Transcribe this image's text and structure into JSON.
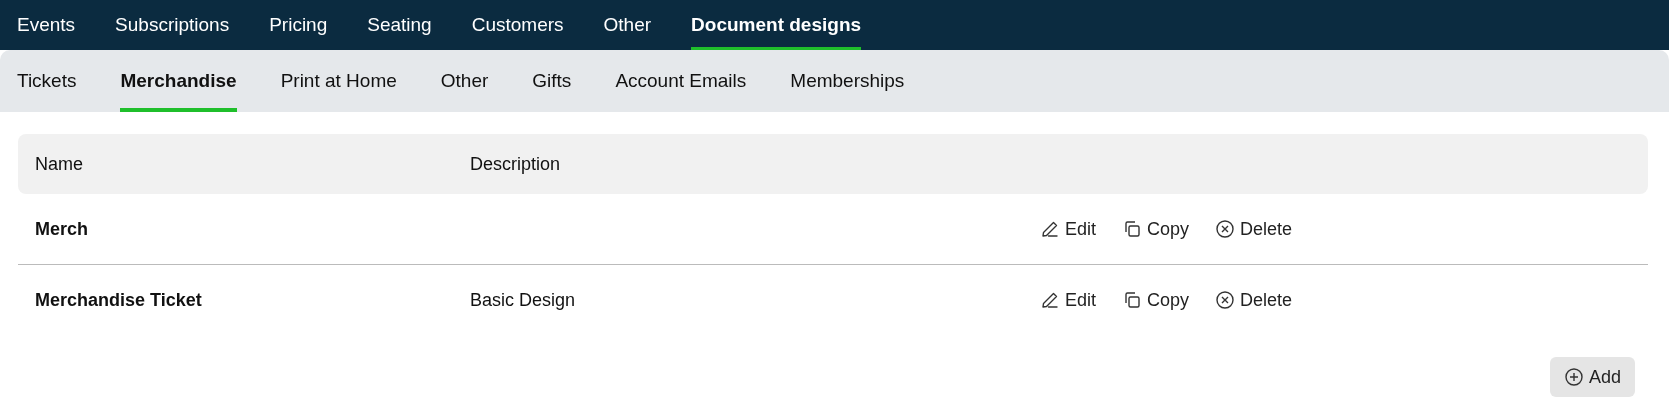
{
  "main_tabs": [
    {
      "label": "Events",
      "selected": false
    },
    {
      "label": "Subscriptions",
      "selected": false
    },
    {
      "label": "Pricing",
      "selected": false
    },
    {
      "label": "Seating",
      "selected": false
    },
    {
      "label": "Customers",
      "selected": false
    },
    {
      "label": "Other",
      "selected": false
    },
    {
      "label": "Document designs",
      "selected": true
    }
  ],
  "sub_tabs": [
    {
      "label": "Tickets",
      "selected": false
    },
    {
      "label": "Merchandise",
      "selected": true
    },
    {
      "label": "Print at Home",
      "selected": false
    },
    {
      "label": "Other",
      "selected": false
    },
    {
      "label": "Gifts",
      "selected": false
    },
    {
      "label": "Account Emails",
      "selected": false
    },
    {
      "label": "Memberships",
      "selected": false
    }
  ],
  "table": {
    "columns": [
      "Name",
      "Description"
    ],
    "rows": [
      {
        "name": "Merch",
        "actions": [
          {
            "kind": "edit",
            "label": "Edit"
          },
          {
            "kind": "copy",
            "label": "Copy"
          },
          {
            "kind": "delete",
            "label": "Delete"
          }
        ]
      },
      {
        "name": "Merchandise Ticket",
        "description": "Basic Design",
        "actions": [
          {
            "kind": "edit",
            "label": "Edit"
          },
          {
            "kind": "copy",
            "label": "Copy"
          },
          {
            "kind": "delete",
            "label": "Delete"
          }
        ]
      }
    ]
  },
  "add_button": "Add"
}
